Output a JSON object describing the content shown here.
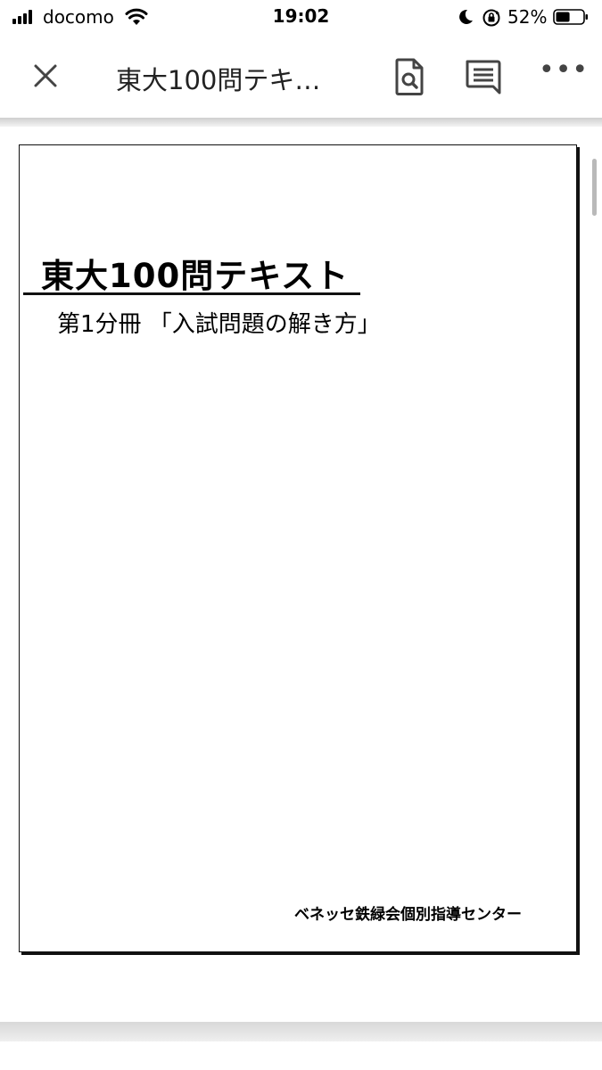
{
  "status_bar": {
    "carrier": "docomo",
    "time": "19:02",
    "battery_percent": "52%",
    "battery_level": 0.52
  },
  "toolbar": {
    "title": "東大100問テキ…",
    "icons": {
      "close": "close-icon",
      "preview": "document-search-icon",
      "comments": "comment-icon",
      "more": "more-icon"
    },
    "more_glyph": "•••"
  },
  "document": {
    "heading": "東大100問テキスト",
    "subheading": "第1分冊 「入試問題の解き方」",
    "publisher": "ベネッセ鉄緑会個別指導センター"
  },
  "colors": {
    "icon": "#444444",
    "page_border": "#111111"
  }
}
